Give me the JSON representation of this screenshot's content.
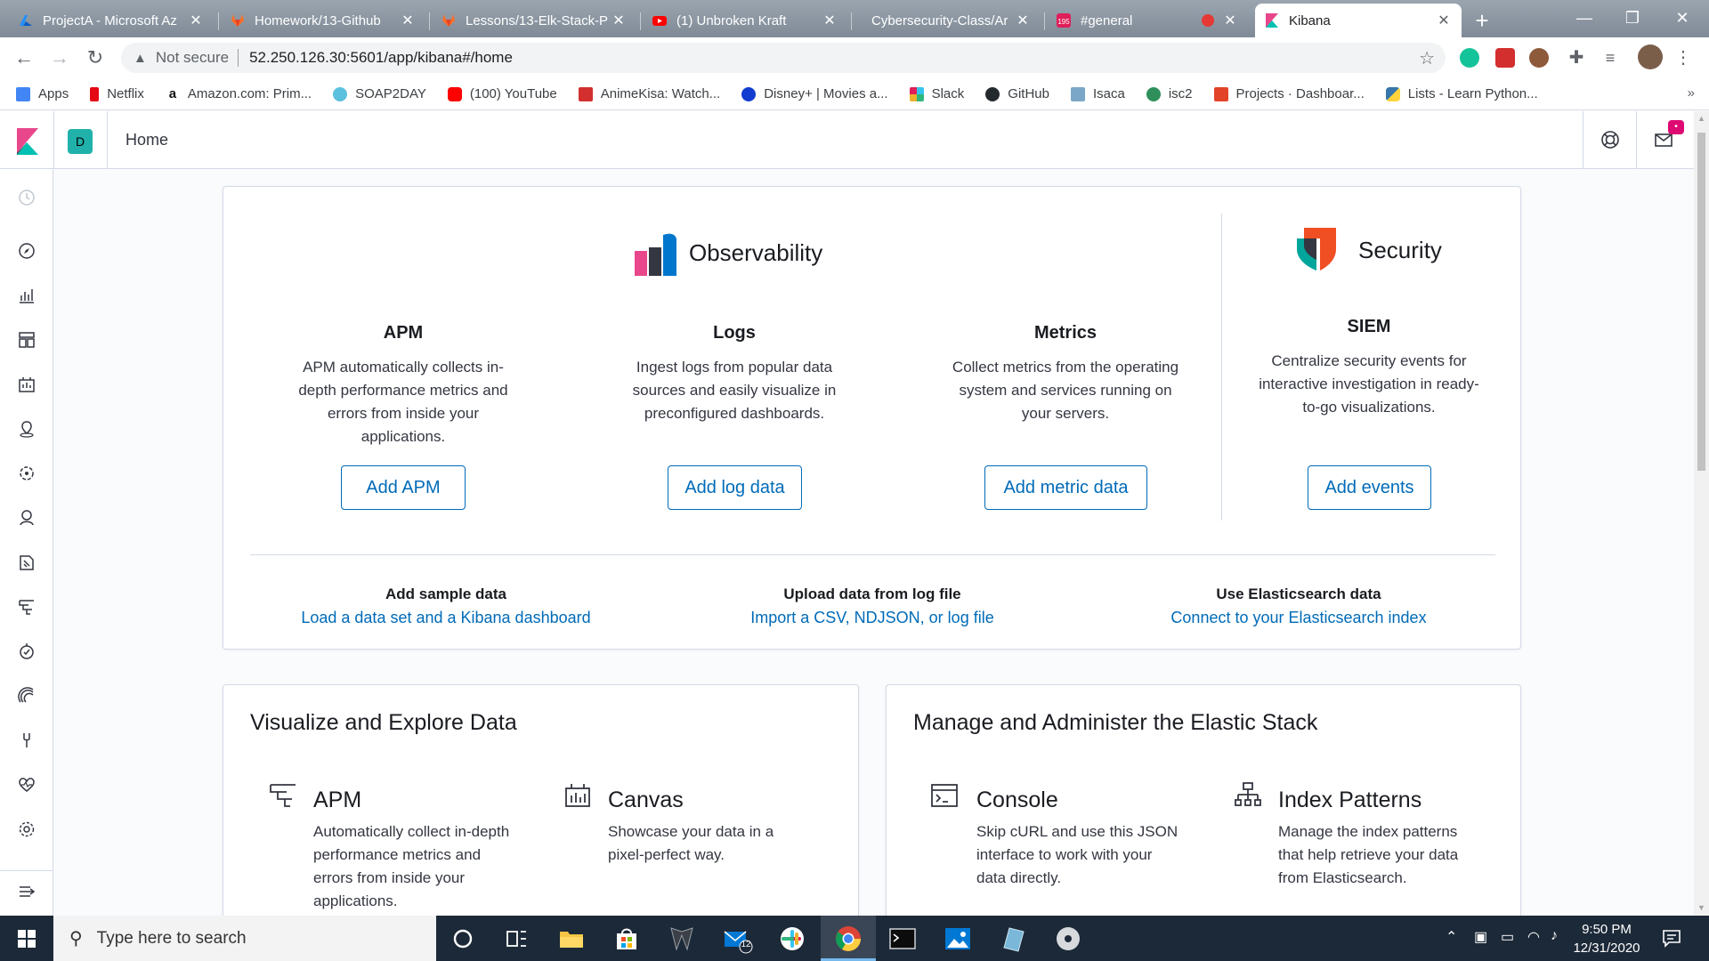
{
  "browser": {
    "tabs": [
      {
        "title": "ProjectA - Microsoft Az",
        "favicon_color": "#0078d4"
      },
      {
        "title": "Homework/13-Github",
        "favicon_color": "#e24329"
      },
      {
        "title": "Lessons/13-Elk-Stack-P",
        "favicon_color": "#e24329"
      },
      {
        "title": "(1) Unbroken Kraft",
        "favicon_color": "#ff0000"
      },
      {
        "title": "Cybersecurity-Class/Ar",
        "favicon_color": "#6e7b88"
      },
      {
        "title": "#general",
        "favicon_color": "#e01e5a"
      },
      {
        "title": "Kibana",
        "favicon_color": "#e8478b"
      }
    ],
    "close_glyph": "✕",
    "new_tab_glyph": "+",
    "address": {
      "security_label": "Not secure",
      "url": "52.250.126.30:5601/app/kibana#/home"
    },
    "bookmarks": [
      {
        "label": "Apps",
        "color": "#4285f4"
      },
      {
        "label": "Netflix",
        "color": "#e50914"
      },
      {
        "label": "Amazon.com: Prim...",
        "color": "#111111"
      },
      {
        "label": "SOAP2DAY",
        "color": "#5bc0de"
      },
      {
        "label": "(100) YouTube",
        "color": "#ff0000"
      },
      {
        "label": "AnimeKisa: Watch...",
        "color": "#d32f2f"
      },
      {
        "label": "Disney+ | Movies a...",
        "color": "#113ccf"
      },
      {
        "label": "Slack",
        "color": "#4a154b"
      },
      {
        "label": "GitHub",
        "color": "#24292e"
      },
      {
        "label": "Isaca",
        "color": "#7aa7c7"
      },
      {
        "label": "isc2",
        "color": "#2f8f5b"
      },
      {
        "label": "Projects · Dashboar...",
        "color": "#e24329"
      },
      {
        "label": "Lists - Learn Python...",
        "color": "#3776ab"
      }
    ],
    "more_bookmarks": "»"
  },
  "kibana": {
    "space_initial": "D",
    "breadcrumb": "Home",
    "news_badge": "•",
    "accent": "#006bb8",
    "observability": {
      "title": "Observability",
      "features": [
        {
          "title": "APM",
          "desc": "APM automatically collects in-depth performance metrics and errors from inside your applications.",
          "button": "Add APM"
        },
        {
          "title": "Logs",
          "desc": "Ingest logs from popular data sources and easily visualize in preconfigured dashboards.",
          "button": "Add log data"
        },
        {
          "title": "Metrics",
          "desc": "Collect metrics from the operating system and services running on your servers.",
          "button": "Add metric data"
        }
      ]
    },
    "security": {
      "title": "Security",
      "feature": {
        "title": "SIEM",
        "desc": "Centralize security events for interactive investigation in ready-to-go visualizations.",
        "button": "Add events"
      }
    },
    "data_links": [
      {
        "title": "Add sample data",
        "link": "Load a data set and a Kibana dashboard"
      },
      {
        "title": "Upload data from log file",
        "link": "Import a CSV, NDJSON, or log file"
      },
      {
        "title": "Use Elasticsearch data",
        "link": "Connect to your Elasticsearch index"
      }
    ],
    "visualize": {
      "title": "Visualize and Explore Data",
      "apps": [
        {
          "title": "APM",
          "desc": "Automatically collect in-depth performance metrics and errors from inside your applications.",
          "icon": "apm-icon"
        },
        {
          "title": "Canvas",
          "desc": "Showcase your data in a pixel-perfect way.",
          "icon": "canvas-icon"
        }
      ]
    },
    "manage": {
      "title": "Manage and Administer the Elastic Stack",
      "apps": [
        {
          "title": "Console",
          "desc": "Skip cURL and use this JSON interface to work with your data directly.",
          "icon": "console-icon"
        },
        {
          "title": "Index Patterns",
          "desc": "Manage the index patterns that help retrieve your data from Elasticsearch.",
          "icon": "index-patterns-icon"
        }
      ]
    }
  },
  "taskbar": {
    "search_placeholder": "Type here to search",
    "mail_badge": "12",
    "time": "9:50 PM",
    "date": "12/31/2020"
  }
}
